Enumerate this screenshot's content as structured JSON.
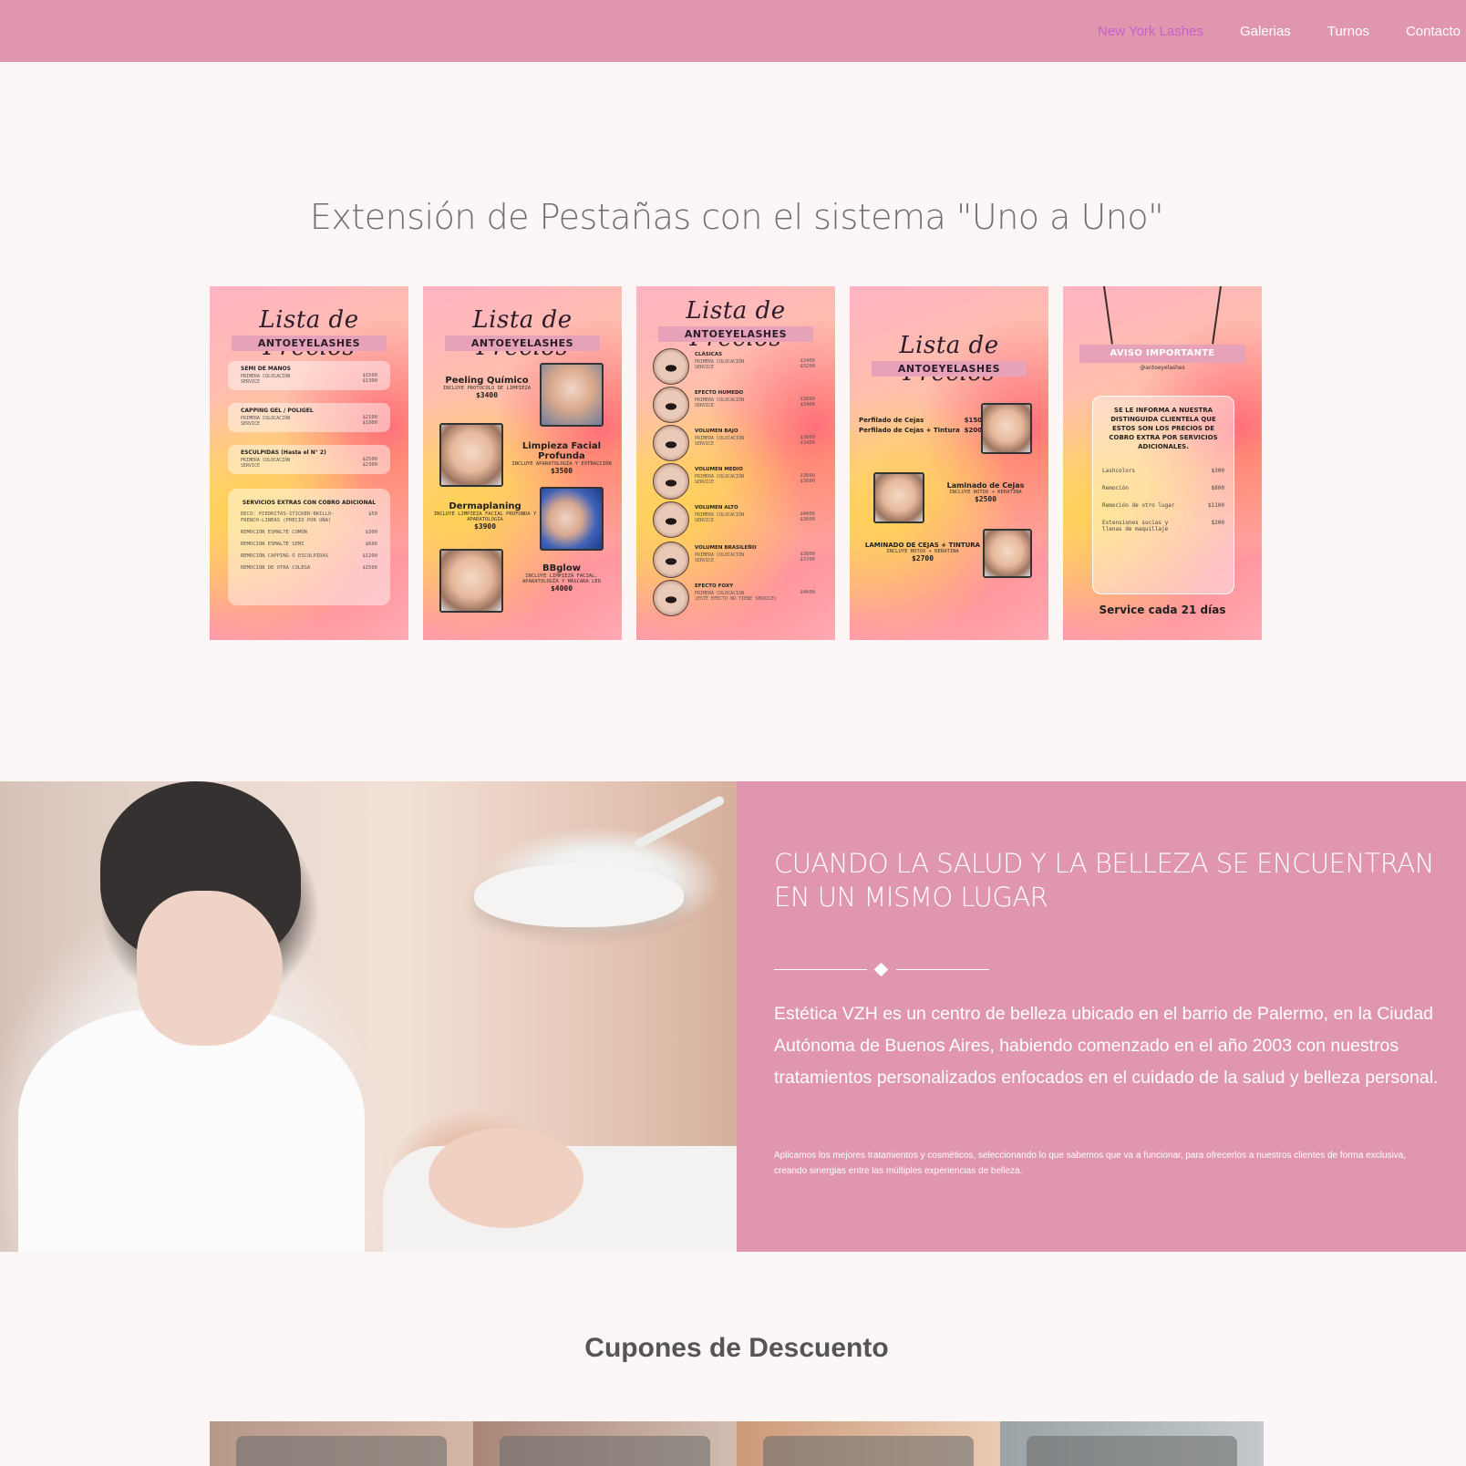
{
  "nav": {
    "items": [
      {
        "label": "New York Lashes",
        "active": true
      },
      {
        "label": "Galerias",
        "active": false
      },
      {
        "label": "Turnos",
        "active": false
      },
      {
        "label": "Contacto",
        "active": false
      }
    ],
    "colors": {
      "bar": "#e096ae",
      "active_link": "#c85fc9",
      "link": "#ffffff"
    }
  },
  "prices_section": {
    "title": "Extensión de Pestañas con el sistema \"Uno a Uno\"",
    "flyers": {
      "heading": "Lista de Precios",
      "brand": "ANTOEYELASHES",
      "nails": {
        "rows": [
          {
            "title": "SEMI DE MANOS",
            "sub": "PRIMERA COLOCACIÓN\nSERVICE",
            "price": "$1500\n$1300"
          },
          {
            "title": "CAPPING GEL / POLIGEL",
            "sub": "PRIMERA COLOCACIÓN\nSERVICE",
            "price": "$2100\n$1900"
          },
          {
            "title": "ESCULPIDAS (Hasta el N° 2)",
            "sub": "PRIMERA COLOCACIÓN\nSERVICE",
            "price": "$2500\n$2300"
          }
        ],
        "extras_title": "SERVICIOS EXTRAS CON COBRO ADICIONAL",
        "extras": [
          {
            "label": "DECO: PIEDRITAS-STICKER-BRILLO-FRENCH-LINEAS (PRECIO POR UÑA)",
            "price": "$50"
          },
          {
            "label": "REMOCIÓN ESMALTE COMÚN",
            "price": "$300"
          },
          {
            "label": "REMOCIÓN ESMALTE SEMI",
            "price": "$600"
          },
          {
            "label": "REMOCIÓN CAPPING O ESCULPIDAS",
            "price": "$1200"
          },
          {
            "label": "REMOCIÓN DE OTRA COLEGA",
            "price": "$1500"
          }
        ]
      },
      "facial": [
        {
          "name": "Peeling Químico",
          "sub": "INCLUYE PROTOCOLO DE LIMPIEZA",
          "price": "$3400"
        },
        {
          "name": "Limpieza Facial Profunda",
          "sub": "INCLUYE APARATOLOGÍA Y EXTRACCIÓN",
          "price": "$3500"
        },
        {
          "name": "Dermaplaning",
          "sub": "INCLUYE LIMPIEZA FACIAL PROFUNDA Y APARATOLOGÍA",
          "price": "$3900"
        },
        {
          "name": "BBglow",
          "sub": "INCLUYE LIMPIEZA FACIAL, APARATOLOGÍA Y MÁSCARA LED",
          "price": "$4000"
        }
      ],
      "lashes": [
        {
          "title": "CLÁSICAS",
          "sub": "PRIMERA COLOCACIÓN\nSERVICE",
          "price": "$3400\n$3200"
        },
        {
          "title": "EFECTO HUMEDO",
          "sub": "PRIMERA COLOCACIÓN\nSERVICE",
          "price": "$3800\n$3400"
        },
        {
          "title": "VOLUMEN BAJO",
          "sub": "PRIMERA COLOCACIÓN\nSERVICE",
          "price": "$3800\n$3400"
        },
        {
          "title": "VOLUMEN MEDIO",
          "sub": "PRIMERA COLOCACIÓN\nSERVICE",
          "price": "$3800\n$3600"
        },
        {
          "title": "VOLUMEN ALTO",
          "sub": "PRIMERA COLOCACIÓN\nSERVICE",
          "price": "$4000\n$3800"
        },
        {
          "title": "VOLUMEN BRASILEÑO",
          "sub": "PRIMERA COLOCACIÓN\nSERVICE",
          "price": "$3800\n$3700"
        },
        {
          "title": "EFECTO FOXY",
          "sub": "PRIMERA COLOCACIÓN\n(ESTE EFECTO NO TIENE SERVICE)",
          "price": "$4000"
        }
      ],
      "brows": [
        {
          "name": "Perfilado de Cejas",
          "price": "$1500"
        },
        {
          "name": "Perfilado de Cejas + Tintura",
          "price": "$2000"
        },
        {
          "name": "Laminado de Cejas",
          "sub": "INCLUYE BOTOX + KERATINA",
          "price": "$2500"
        },
        {
          "name": "LAMINADO DE CEJAS + TINTURA",
          "sub": "INCLUYE BOTOX + KERATINA",
          "price": "$2700"
        }
      ],
      "notice": {
        "banner": "AVISO IMPORTANTE",
        "handle": "@antoeyelashes",
        "text": "SE LE INFORMA A NUESTRA DISTINGUIDA CLIENTELA QUE ESTOS SON LOS PRECIOS DE COBRO EXTRA POR SERVICIOS ADICIONALES.",
        "items": [
          {
            "label": "Lashcolors",
            "price": "$300"
          },
          {
            "label": "Remoción",
            "price": "$800"
          },
          {
            "label": "Remoción de otro lugar",
            "price": "$1100"
          },
          {
            "label": "Extensiones sucias y llenas de maquillaje",
            "price": "$200"
          }
        ],
        "footer": "Service cada 21 días"
      }
    }
  },
  "about": {
    "heading": "CUANDO LA SALUD Y LA BELLEZA SE ENCUENTRAN EN UN MISMO LUGAR",
    "lead": "Estética VZH es un centro de belleza ubicado en el barrio de Palermo, en la Ciudad Autónoma de Buenos Aires, habiendo comenzado en el año 2003 con nuestros tratamientos personalizados enfocados en el cuidado de la salud y belleza personal.",
    "small": "Aplicamos los mejores tratamientos y cosméticos, seleccionando lo que sabemos que va a funcionar, para ofrecerlos a nuestros clientes de forma exclusiva, creando sinergias entre las múltiples experiencias de belleza.",
    "panel_color": "#e096ae"
  },
  "coupons": {
    "title": "Cupones de Descuento"
  }
}
